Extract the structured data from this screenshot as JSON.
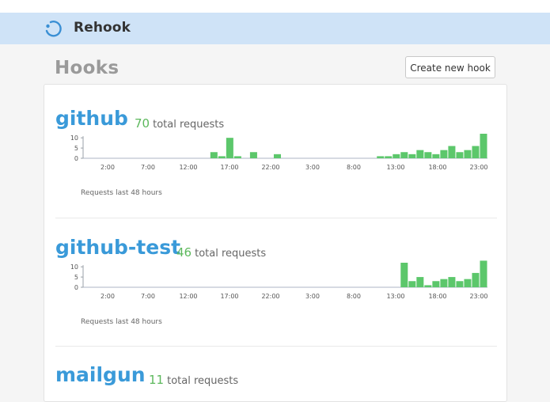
{
  "app": {
    "name": "Rehook"
  },
  "page": {
    "title": "Hooks"
  },
  "actions": {
    "create_label": "Create new hook"
  },
  "chart_caption": "Requests last 48 hours",
  "colors": {
    "bar": "#5cc76b",
    "accent": "#3a9ad9",
    "count": "#5cb85c",
    "navbar": "#cfe3f7"
  },
  "hooks": [
    {
      "name": "github",
      "count": "70",
      "count_unit": "total requests",
      "chart_data": {
        "type": "bar",
        "title": "",
        "xlabel": "Requests last 48 hours",
        "ylabel": "",
        "y_ticks": [
          "10",
          "5",
          "0"
        ],
        "x_ticks": [
          "2:00",
          "7:00",
          "12:00",
          "17:00",
          "22:00",
          "3:00",
          "8:00",
          "13:00",
          "18:00",
          "23:00"
        ],
        "ylim": [
          0,
          12
        ],
        "values": [
          0,
          0,
          0,
          0,
          0,
          0,
          0,
          0,
          0,
          0,
          0,
          0,
          0,
          0,
          0,
          0,
          3,
          1,
          10,
          1,
          0,
          3,
          0,
          0,
          2,
          0,
          0,
          0,
          0,
          0,
          0,
          0,
          0,
          0,
          0,
          0,
          0,
          1,
          1,
          2,
          3,
          2,
          4,
          3,
          2,
          4,
          6,
          3,
          4,
          6,
          12
        ]
      }
    },
    {
      "name": "github-test",
      "count": "46",
      "count_unit": "total requests",
      "chart_data": {
        "type": "bar",
        "title": "",
        "xlabel": "Requests last 48 hours",
        "ylabel": "",
        "y_ticks": [
          "10",
          "5",
          "0"
        ],
        "x_ticks": [
          "2:00",
          "7:00",
          "12:00",
          "17:00",
          "22:00",
          "3:00",
          "8:00",
          "13:00",
          "18:00",
          "23:00"
        ],
        "ylim": [
          0,
          12
        ],
        "values": [
          0,
          0,
          0,
          0,
          0,
          0,
          0,
          0,
          0,
          0,
          0,
          0,
          0,
          0,
          0,
          0,
          0,
          0,
          0,
          0,
          0,
          0,
          0,
          0,
          0,
          0,
          0,
          0,
          0,
          0,
          0,
          0,
          0,
          0,
          0,
          0,
          0,
          0,
          0,
          0,
          12,
          3,
          5,
          1,
          3,
          4,
          5,
          3,
          4,
          7,
          13
        ]
      }
    },
    {
      "name": "mailgun",
      "count": "11",
      "count_unit": "total requests"
    }
  ]
}
